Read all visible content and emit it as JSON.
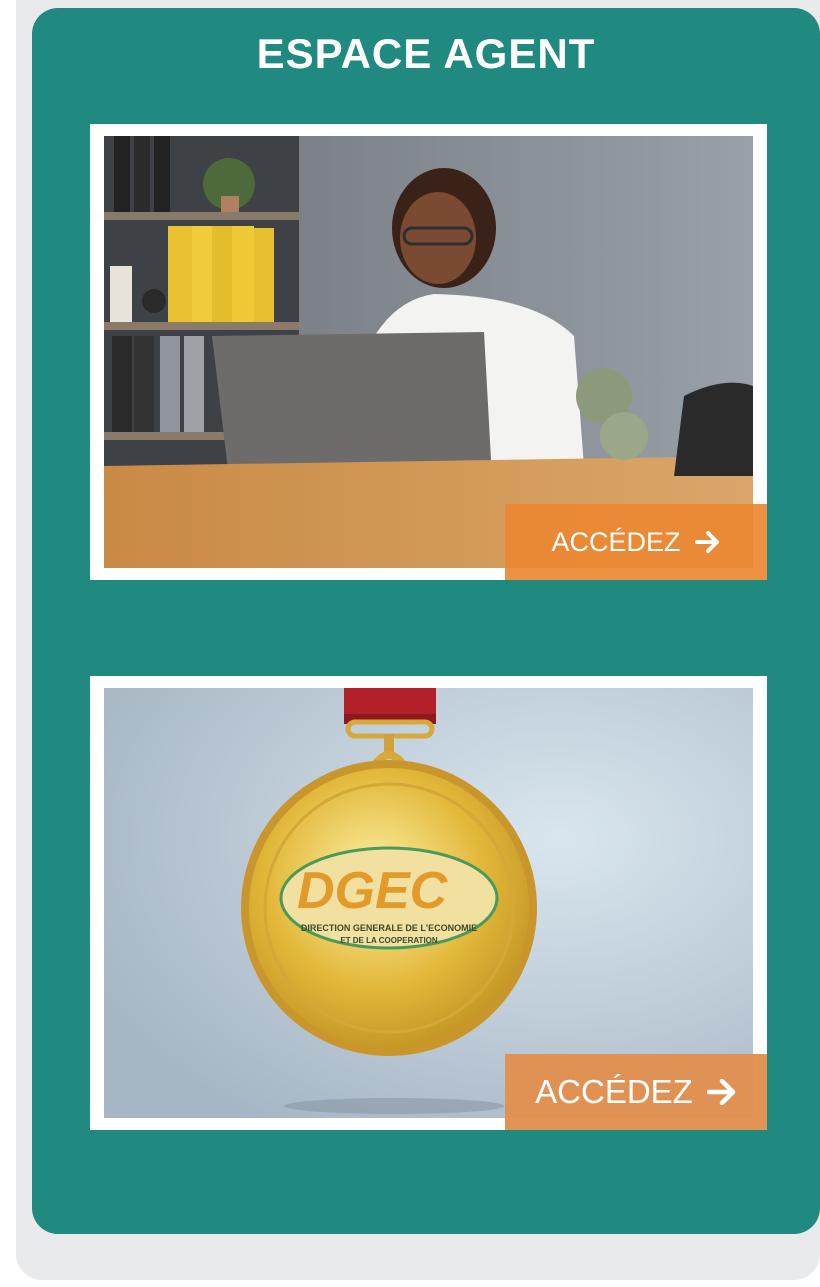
{
  "section": {
    "title": "ESPACE AGENT"
  },
  "cards": [
    {
      "image": "woman-working-on-laptop-at-desk",
      "cta_label": "ACCÉDEZ",
      "cta_icon": "arrow-right-icon"
    },
    {
      "image": "gold-medal-with-dgec-logo",
      "cta_label": "ACCÉDEZ",
      "cta_icon": "arrow-right-icon",
      "logo": {
        "letters": "DGEC",
        "line1": "DIRECTION GENERALE DE L'ECONOMIE",
        "line2": "ET DE LA COOPERATION"
      }
    }
  ],
  "colors": {
    "panel": "#218a80",
    "cta": "#ec8832",
    "background": "#e9eaec"
  }
}
